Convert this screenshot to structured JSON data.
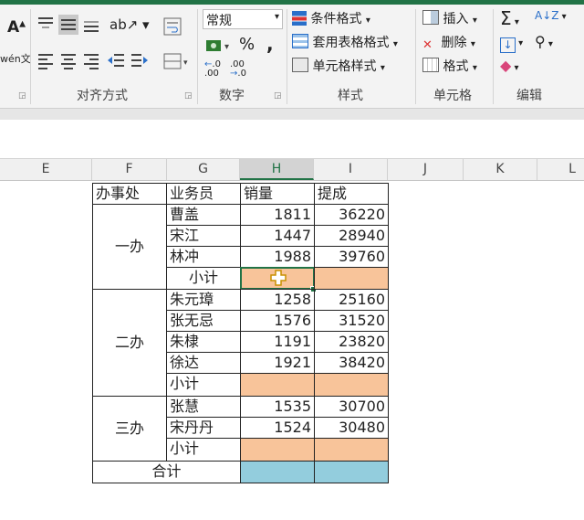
{
  "ribbon": {
    "number_format": "常规",
    "percent": "%",
    "comma": ",",
    "cond_format": "条件格式",
    "table_format": "套用表格格式",
    "cell_style": "单元格样式",
    "insert": "插入",
    "delete": "删除",
    "format": "格式",
    "sigma": "Σ",
    "groups": {
      "alignment": "对齐方式",
      "number": "数字",
      "styles": "样式",
      "cells": "单元格",
      "editing": "编辑"
    },
    "font_a": "A",
    "phonetic": "wén文",
    "inc_dec": ".00",
    "dec_dec": ".0"
  },
  "columns": [
    "E",
    "F",
    "G",
    "H",
    "I",
    "J",
    "K",
    "L"
  ],
  "headers": {
    "office": "办事处",
    "staff": "业务员",
    "sales": "销量",
    "commission": "提成"
  },
  "groups": [
    {
      "office": "一办",
      "rows": [
        {
          "name": "曹盖",
          "sales": "1811",
          "commission": "36220"
        },
        {
          "name": "宋江",
          "sales": "1447",
          "commission": "28940"
        },
        {
          "name": "林冲",
          "sales": "1988",
          "commission": "39760"
        }
      ],
      "subtotal": "小计"
    },
    {
      "office": "二办",
      "rows": [
        {
          "name": "朱元璋",
          "sales": "1258",
          "commission": "25160"
        },
        {
          "name": "张无忌",
          "sales": "1576",
          "commission": "31520"
        },
        {
          "name": "朱棣",
          "sales": "1191",
          "commission": "23820"
        },
        {
          "name": "徐达",
          "sales": "1921",
          "commission": "38420"
        }
      ],
      "subtotal": "小计"
    },
    {
      "office": "三办",
      "rows": [
        {
          "name": "张慧",
          "sales": "1535",
          "commission": "30700"
        },
        {
          "name": "宋丹丹",
          "sales": "1524",
          "commission": "30480"
        }
      ],
      "subtotal": "小计"
    }
  ],
  "total": "合计",
  "colors": {
    "accent": "#217346",
    "subtotal_fill": "#f8c49a",
    "total_fill": "#93cddd"
  }
}
